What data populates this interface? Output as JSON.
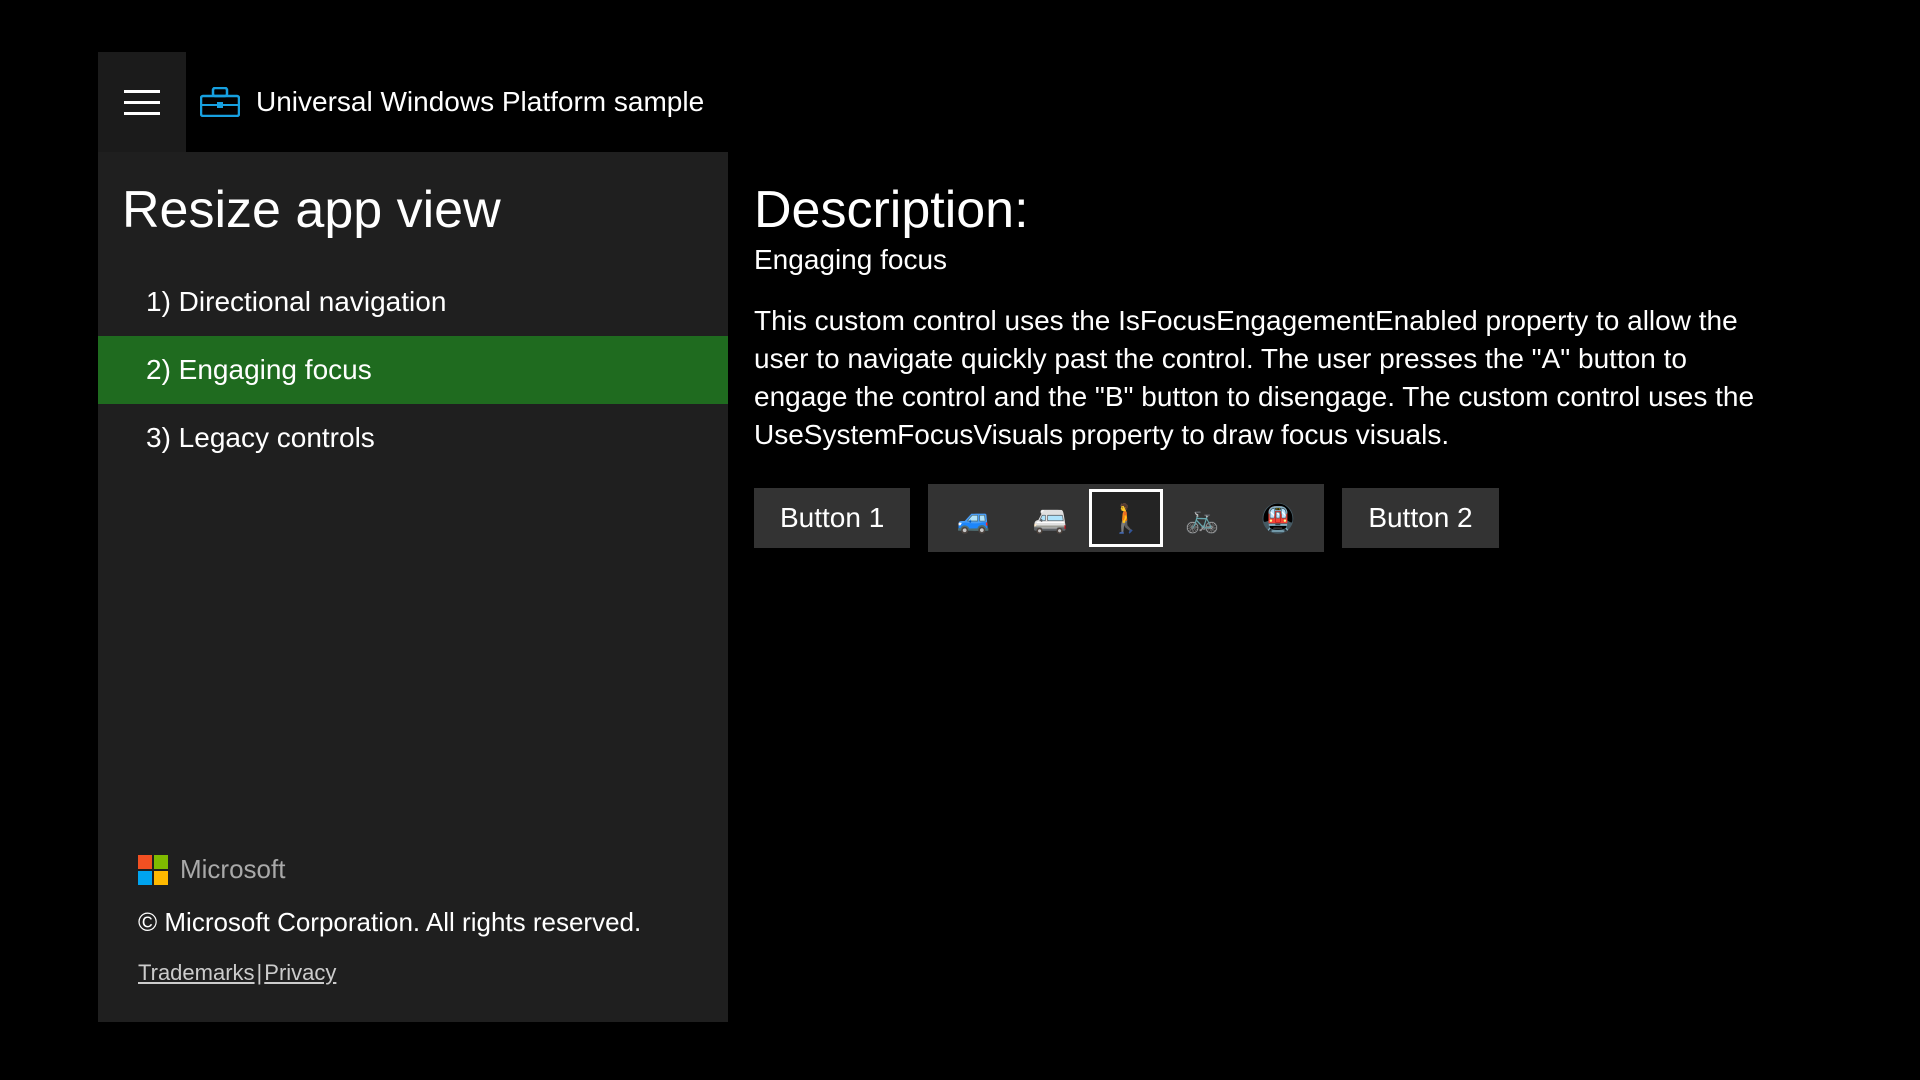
{
  "header": {
    "app_title": "Universal Windows Platform sample"
  },
  "sidebar": {
    "title": "Resize app view",
    "items": [
      {
        "label": "1) Directional navigation",
        "selected": false
      },
      {
        "label": "2) Engaging focus",
        "selected": true
      },
      {
        "label": "3) Legacy controls",
        "selected": false
      }
    ],
    "footer": {
      "brand": "Microsoft",
      "copyright": "© Microsoft Corporation. All rights reserved.",
      "links": {
        "trademarks": "Trademarks",
        "privacy": "Privacy"
      }
    }
  },
  "content": {
    "heading": "Description:",
    "subtitle": "Engaging focus",
    "body": "This custom control uses the IsFocusEngagementEnabled property to allow the user to navigate quickly past the control. The user presses the \"A\" button to engage the control and the \"B\" button to disengage. The custom control uses the UseSystemFocusVisuals property to draw focus visuals.",
    "button1": "Button 1",
    "button2": "Button 2",
    "strip": {
      "items": [
        {
          "glyph": "🚙",
          "name": "car-icon",
          "focused": false
        },
        {
          "glyph": "🚐",
          "name": "van-icon",
          "focused": false
        },
        {
          "glyph": "🚶",
          "name": "pedestrian-icon",
          "focused": true
        },
        {
          "glyph": "🚲",
          "name": "bicycle-icon",
          "focused": false
        },
        {
          "glyph": "🚇",
          "name": "metro-icon",
          "focused": false
        }
      ]
    }
  }
}
